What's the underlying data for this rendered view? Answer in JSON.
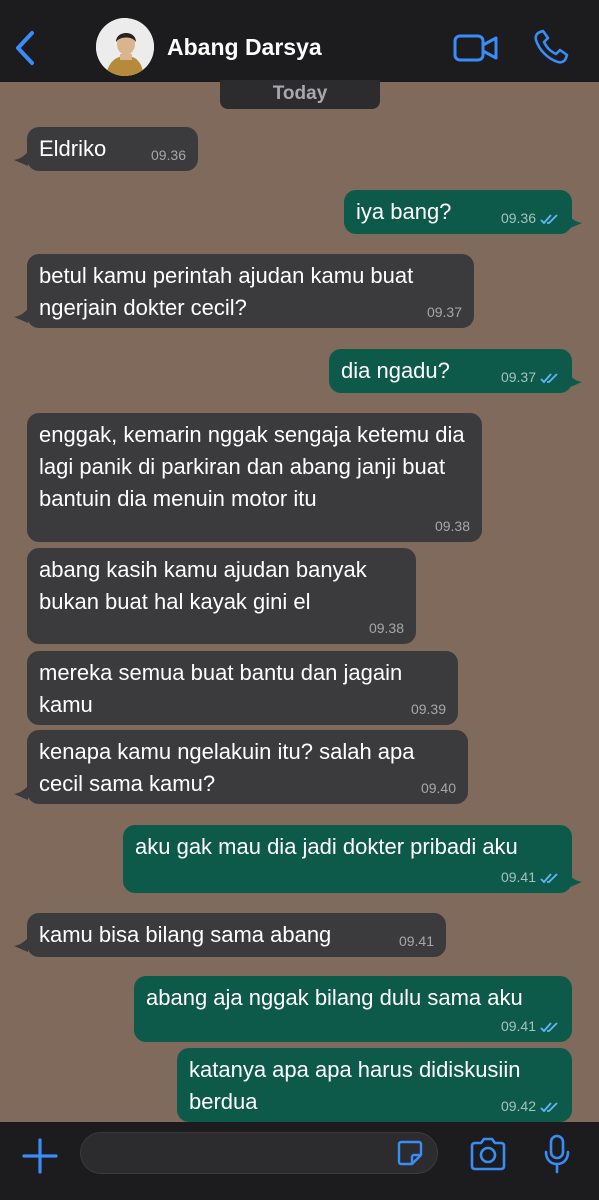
{
  "header": {
    "contact_name": "Abang Darsya",
    "back_icon": "chevron-left-icon",
    "video_icon": "video-camera-icon",
    "call_icon": "phone-icon"
  },
  "date_divider": "Today",
  "messages": [
    {
      "side": "in",
      "text": "Eldriko",
      "time": "09.36"
    },
    {
      "side": "out",
      "text": "iya bang?",
      "time": "09.36"
    },
    {
      "side": "in",
      "text": "betul kamu perintah ajudan kamu buat ngerjain dokter cecil?",
      "time": "09.37"
    },
    {
      "side": "out",
      "text": "dia ngadu?",
      "time": "09.37"
    },
    {
      "side": "in",
      "text": "enggak, kemarin nggak sengaja ketemu dia lagi panik di parkiran dan abang janji buat bantuin dia menuin motor itu",
      "time": "09.38"
    },
    {
      "side": "in",
      "text": "abang kasih kamu ajudan banyak bukan buat hal kayak gini el",
      "time": "09.38"
    },
    {
      "side": "in",
      "text": "mereka semua buat bantu dan jagain kamu",
      "time": "09.39"
    },
    {
      "side": "in",
      "text": "kenapa kamu ngelakuin itu? salah apa cecil sama kamu?",
      "time": "09.40"
    },
    {
      "side": "out",
      "text": "aku gak mau dia jadi dokter pribadi aku",
      "time": "09.41"
    },
    {
      "side": "in",
      "text": "kamu bisa bilang sama abang",
      "time": "09.41"
    },
    {
      "side": "out",
      "text": "abang aja nggak bilang dulu sama aku",
      "time": "09.41"
    },
    {
      "side": "out",
      "text": "katanya apa apa harus didiskusiin berdua",
      "time": "09.42"
    }
  ],
  "composer": {
    "plus_icon": "plus-icon",
    "sticker_icon": "sticker-icon",
    "camera_icon": "camera-icon",
    "mic_icon": "microphone-icon"
  },
  "colors": {
    "incoming_bubble": "#3b3b3d",
    "outgoing_bubble": "#0d5a4b",
    "accent": "#3a8df7",
    "read_ticks": "#5fb7f5",
    "chat_background": "#7f6a5c"
  }
}
